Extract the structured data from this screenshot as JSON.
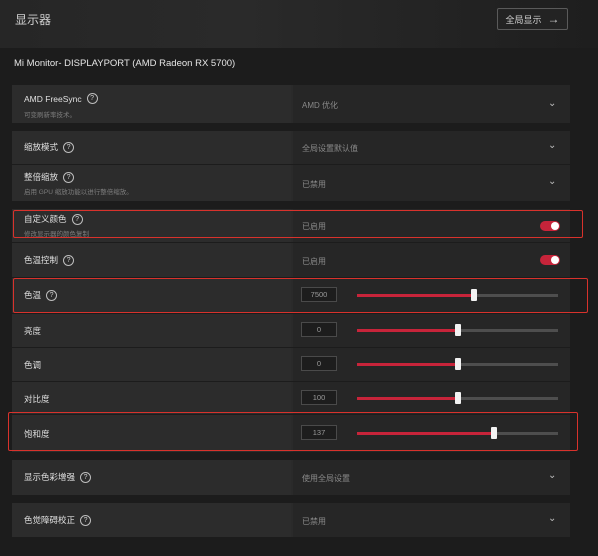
{
  "header": {
    "title": "显示器",
    "global_button": "全局显示",
    "global_button_arrow": "arrow-right-icon"
  },
  "monitor": "Mi Monitor- DISPLAYPORT (AMD Radeon RX 5700)",
  "settings": {
    "freesync": {
      "label": "AMD FreeSync",
      "sub": "可变刷新率技术。",
      "value": "AMD 优化"
    },
    "scaling_mode": {
      "label": "缩放模式",
      "value": "全局设置默认值"
    },
    "integer_scaling": {
      "label": "整倍缩放",
      "sub": "启用 GPU 缩放功能以进行整倍缩放。",
      "value": "已禁用"
    },
    "custom_color": {
      "label": "自定义颜色",
      "sub": "修改显示器的颜色复制",
      "value": "已启用",
      "enabled": true
    },
    "color_temp_control": {
      "label": "色温控制",
      "value": "已启用",
      "enabled": true
    },
    "color_temp": {
      "label": "色温",
      "value": "7500",
      "level_pct": 58
    },
    "brightness": {
      "label": "亮度",
      "value": "0",
      "level_pct": 50
    },
    "hue": {
      "label": "色调",
      "value": "0",
      "level_pct": 50
    },
    "contrast": {
      "label": "对比度",
      "value": "100",
      "level_pct": 50
    },
    "saturation": {
      "label": "饱和度",
      "value": "137",
      "level_pct": 68
    },
    "color_enhance": {
      "label": "显示色彩增强",
      "value": "使用全局设置"
    },
    "color_blind": {
      "label": "色觉障碍校正",
      "value": "已禁用"
    }
  },
  "accent_color": "#c7243a",
  "highlight_color": "#d8322c"
}
